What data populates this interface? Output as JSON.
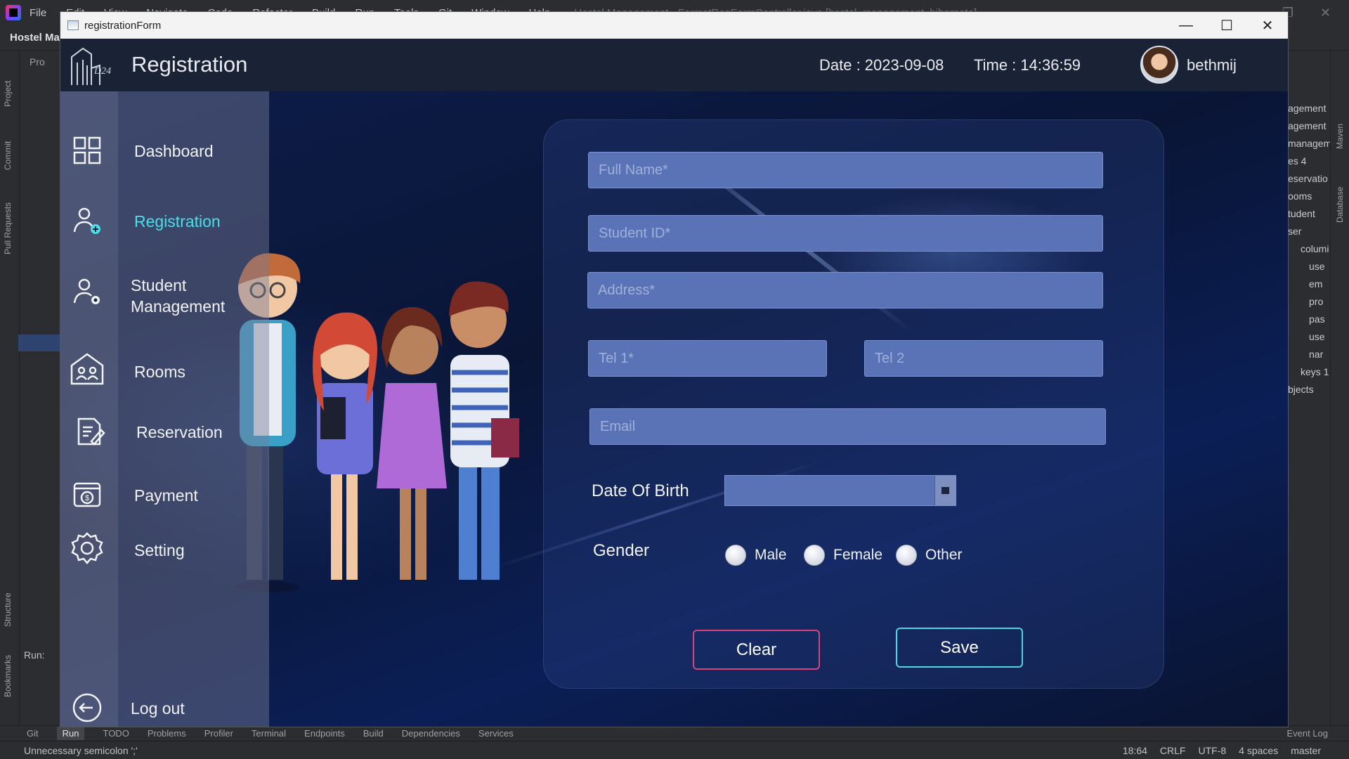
{
  "ide": {
    "menu": [
      "File",
      "Edit",
      "View",
      "Navigate",
      "Code",
      "Refactor",
      "Build",
      "Run",
      "Tools",
      "Git",
      "Window",
      "Help"
    ],
    "menu_path": "Hostel Management - FormatRegFormController.java [hostel_management_hibernate]",
    "project_title": "Hostel Ma",
    "left_tabs": [
      "Project",
      "Commit",
      "Pull Requests",
      "Structure",
      "Bookmarks"
    ],
    "panel_label_pro": "Pro",
    "run_label": "Run:",
    "right_tabs": [
      "Maven",
      "Database"
    ],
    "right_items": [
      "agement",
      "agement",
      "managem",
      "es 4",
      "eservatio",
      "ooms",
      "tudent",
      "ser",
      "columi",
      "use",
      "em",
      "pro",
      "pas",
      "use",
      "nar",
      "keys 1",
      "bjects"
    ],
    "bottom_tools": [
      "Git",
      "Run",
      "TODO",
      "Problems",
      "Profiler",
      "Terminal",
      "Endpoints",
      "Build",
      "Dependencies",
      "Services"
    ],
    "active_tool": "Run",
    "event_log": "Event Log",
    "status_message": "Unnecessary semicolon ';'",
    "status_right": [
      "18:64",
      "CRLF",
      "UTF-8",
      "4 spaces",
      "master"
    ]
  },
  "window": {
    "title": "registrationForm",
    "controls": {
      "minimize": "—",
      "maximize": "☐",
      "close": "✕"
    }
  },
  "header": {
    "logo_text": "D24",
    "page_title": "Registration",
    "date": "Date : 2023-09-08",
    "time": "Time : 14:36:59",
    "username": "bethmij"
  },
  "sidebar": {
    "items": [
      {
        "label": "Dashboard",
        "icon": "grid-icon"
      },
      {
        "label": "Registration",
        "icon": "add-user-icon",
        "active": true
      },
      {
        "label": "Student\nManagement",
        "icon": "user-settings-icon"
      },
      {
        "label": "Rooms",
        "icon": "rooms-icon"
      },
      {
        "label": "Reservation",
        "icon": "edit-document-icon"
      },
      {
        "label": "Payment",
        "icon": "payment-icon"
      },
      {
        "label": "Setting",
        "icon": "gear-icon"
      }
    ],
    "logout_label": "Log out"
  },
  "form": {
    "full_name_placeholder": "Full Name*",
    "student_id_placeholder": "Student ID*",
    "address_placeholder": "Address*",
    "tel1_placeholder": "Tel 1*",
    "tel2_placeholder": "Tel 2",
    "email_placeholder": "Email",
    "dob_label": "Date Of Birth",
    "gender_label": "Gender",
    "gender_options": [
      "Male",
      "Female",
      "Other"
    ],
    "clear_label": "Clear",
    "save_label": "Save"
  },
  "colors": {
    "accent_active": "#47e0ea",
    "clear_border": "#d8447a",
    "save_border": "#4fd6e2",
    "field_bg": "#5a73b6"
  }
}
